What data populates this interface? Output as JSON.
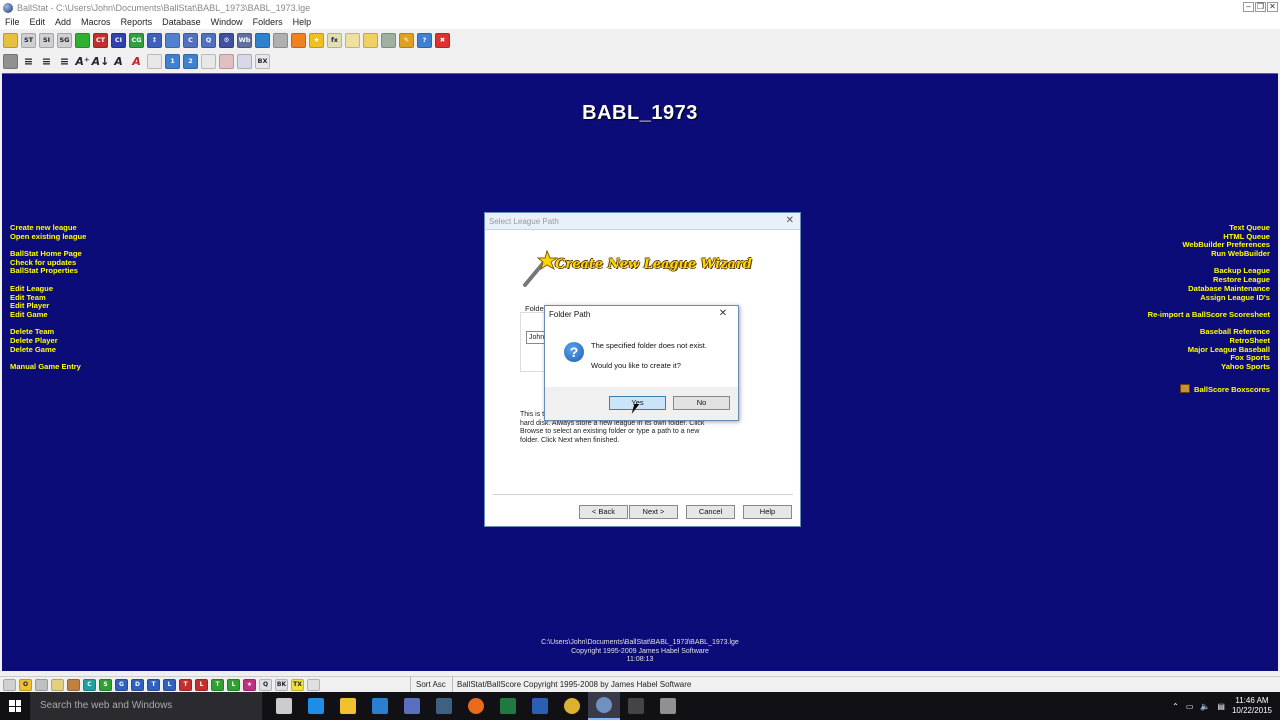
{
  "window": {
    "title": "BallStat - C:\\Users\\John\\Documents\\BallStat\\BABL_1973\\BABL_1973.lge",
    "buttons": [
      "minimize",
      "restore",
      "close"
    ]
  },
  "menu": [
    "File",
    "Edit",
    "Add",
    "Macros",
    "Reports",
    "Database",
    "Window",
    "Folders",
    "Help"
  ],
  "toolbar1": [
    {
      "icon": "open-folder-icon",
      "text": "",
      "color": "#e8c040"
    },
    {
      "icon": "st-icon",
      "text": "ST",
      "color": "#d0d0d0"
    },
    {
      "icon": "si-icon",
      "text": "SI",
      "color": "#d0d0d0"
    },
    {
      "icon": "sg-icon",
      "text": "SG",
      "color": "#d0d0d0"
    },
    {
      "icon": "green-circle-icon",
      "text": "",
      "color": "#30b030"
    },
    {
      "icon": "ct-icon",
      "text": "CT",
      "color": "#c03030"
    },
    {
      "icon": "ci-icon",
      "text": "CI",
      "color": "#3040b0"
    },
    {
      "icon": "cg-icon",
      "text": "CG",
      "color": "#30a040"
    },
    {
      "icon": "sort-icon",
      "text": "↕",
      "color": "#4060c0"
    },
    {
      "icon": "folder-blue-icon",
      "text": "",
      "color": "#5080d0"
    },
    {
      "icon": "c-icon",
      "text": "C",
      "color": "#5070c0"
    },
    {
      "icon": "q-icon",
      "text": "Q",
      "color": "#5070c0"
    },
    {
      "icon": "gear-icon",
      "text": "⚙",
      "color": "#4050a0"
    },
    {
      "icon": "wb-icon",
      "text": "Wb",
      "color": "#6070a0"
    },
    {
      "icon": "globe-icon",
      "text": "",
      "color": "#3080d0"
    },
    {
      "icon": "link-icon",
      "text": "",
      "color": "#b0b0b0"
    },
    {
      "icon": "orange-icon",
      "text": "",
      "color": "#f08020"
    },
    {
      "icon": "star-icon",
      "text": "★",
      "color": "#f0c020"
    },
    {
      "icon": "fx-icon",
      "text": "fx",
      "color": "#e0e0b0"
    },
    {
      "icon": "clipboard-icon",
      "text": "",
      "color": "#f0e0a0"
    },
    {
      "icon": "folder-icon",
      "text": "",
      "color": "#f0d060"
    },
    {
      "icon": "grid-icon",
      "text": "",
      "color": "#a0b0a0"
    },
    {
      "icon": "pencil-icon",
      "text": "✎",
      "color": "#e0a020"
    },
    {
      "icon": "help-icon",
      "text": "?",
      "color": "#4080d0"
    },
    {
      "icon": "close-icon",
      "text": "✖",
      "color": "#e03030"
    }
  ],
  "toolbar2": [
    {
      "icon": "print-icon",
      "text": "",
      "color": "#909090"
    },
    {
      "icon": "align-left-icon",
      "text": "≡",
      "color": "#f0f0f0"
    },
    {
      "icon": "align-center-icon",
      "text": "≡",
      "color": "#f0f0f0"
    },
    {
      "icon": "align-right-icon",
      "text": "≡",
      "color": "#f0f0f0"
    },
    {
      "icon": "font-larger-icon",
      "text": "A⁺",
      "color": "#f0f0f0"
    },
    {
      "icon": "font-smaller-icon",
      "text": "A↓",
      "color": "#f0f0f0"
    },
    {
      "icon": "font-icon",
      "text": "A",
      "color": "#f0f0f0"
    },
    {
      "icon": "font-red-icon",
      "text": "A",
      "color": "#f0f0f0"
    },
    {
      "icon": "page-icon",
      "text": "",
      "color": "#e8e8e8"
    },
    {
      "icon": "callout-icon",
      "text": "1",
      "color": "#4080d0"
    },
    {
      "icon": "callout2-icon",
      "text": "2",
      "color": "#4080d0"
    },
    {
      "icon": "doc-icon",
      "text": "",
      "color": "#e8e8e8"
    },
    {
      "icon": "doc-red-icon",
      "text": "",
      "color": "#e0c0c0"
    },
    {
      "icon": "table-icon",
      "text": "",
      "color": "#d8d8e8"
    },
    {
      "icon": "bx-icon",
      "text": "BX",
      "color": "#e8e8e8"
    }
  ],
  "main": {
    "title": "BABL_1973",
    "bg_color": "#0c0c78",
    "link_color": "#ffff00",
    "left_links": [
      [
        "Create new league",
        "Open existing league"
      ],
      [
        "BallStat Home Page",
        "Check for updates",
        "BallStat Properties"
      ],
      [
        "Edit League",
        "Edit Team",
        "Edit Player",
        "Edit Game"
      ],
      [
        "Delete Team",
        "Delete Player",
        "Delete Game"
      ],
      [
        "Manual Game Entry"
      ]
    ],
    "right_links": [
      [
        "Text Queue",
        "HTML Queue",
        "WebBuilder Preferences",
        "Run WebBuilder"
      ],
      [
        "Backup League",
        "Restore League",
        "Database Maintenance",
        "Assign League ID's"
      ],
      [
        "Re-import a BallScore Scoresheet"
      ],
      [
        "Baseball Reference",
        "RetroSheet",
        "Major League Baseball",
        "Fox Sports",
        "Yahoo Sports"
      ],
      [
        "BallScore Boxscores"
      ]
    ],
    "footer": {
      "path": "C:\\Users\\John\\Documents\\BallStat\\BABL_1973\\BABL_1973.lge",
      "copyright": "Copyright 1995-2009 James Habel Software",
      "time": "11:08:13"
    }
  },
  "wizard": {
    "title": "Select League Path",
    "banner": "Create New League Wizard",
    "folder_label": "Folder",
    "folder_value": "John",
    "description_prefix": "This is t",
    "description_rest": "hard disk. Always store a new league in its own folder. Click Browse to select an existing folder or type a path to a new folder. Click Next when finished.",
    "buttons": {
      "back": "< Back",
      "next": "Next >",
      "cancel": "Cancel",
      "help": "Help"
    }
  },
  "msgbox": {
    "title": "Folder Path",
    "line1": "The specified folder does not exist.",
    "line2": "Would you like to create it?",
    "yes": "Yes",
    "no": "No"
  },
  "statusbar": {
    "icons": [
      {
        "icon": "edit-icon",
        "text": "",
        "color": "#d0d0d0"
      },
      {
        "icon": "o-icon",
        "text": "O",
        "color": "#f0c030"
      },
      {
        "icon": "book-icon",
        "text": "",
        "color": "#c0c0c0"
      },
      {
        "icon": "folder-open-icon",
        "text": "",
        "color": "#e0d080"
      },
      {
        "icon": "box-icon",
        "text": "",
        "color": "#c08040"
      },
      {
        "icon": "c-green-icon",
        "text": "C",
        "color": "#20a0a0"
      },
      {
        "icon": "s-green-icon",
        "text": "S",
        "color": "#30a030"
      },
      {
        "icon": "g-blue-icon",
        "text": "G",
        "color": "#3060c0"
      },
      {
        "icon": "d-blue-icon",
        "text": "D",
        "color": "#3060c0"
      },
      {
        "icon": "t-blue-icon",
        "text": "T",
        "color": "#3060c0"
      },
      {
        "icon": "l-blue-icon",
        "text": "L",
        "color": "#3060c0"
      },
      {
        "icon": "t-red-icon",
        "text": "T",
        "color": "#c03030"
      },
      {
        "icon": "l-red-icon",
        "text": "L",
        "color": "#c03030"
      },
      {
        "icon": "t-green-icon",
        "text": "T",
        "color": "#30a030"
      },
      {
        "icon": "l-green-icon",
        "text": "L",
        "color": "#30a030"
      },
      {
        "icon": "star-red-icon",
        "text": "★",
        "color": "#c03080"
      },
      {
        "icon": "q-white-icon",
        "text": "Q",
        "color": "#e0e0e0"
      },
      {
        "icon": "bk-icon",
        "text": "BK",
        "color": "#e0e0e0"
      },
      {
        "icon": "tx-icon",
        "text": "TX",
        "color": "#f0e040"
      },
      {
        "icon": "chart-icon",
        "text": "",
        "color": "#e0e0e0"
      }
    ],
    "sort": "Sort Asc",
    "copyright": "BallStat/BallScore  Copyright 1995-2008 by James Habel Software"
  },
  "taskbar": {
    "search_placeholder": "Search the web and Windows",
    "apps": [
      {
        "icon": "task-view-icon",
        "color": "#cccccc"
      },
      {
        "icon": "edge-icon",
        "color": "#1f8ce6"
      },
      {
        "icon": "file-explorer-icon",
        "color": "#f0c030"
      },
      {
        "icon": "store-icon",
        "color": "#2a7fd0"
      },
      {
        "icon": "media-icon",
        "color": "#5a6fc0"
      },
      {
        "icon": "app-icon",
        "color": "#406080"
      },
      {
        "icon": "firefox-icon",
        "color": "#e86a1a"
      },
      {
        "icon": "excel-icon",
        "color": "#1f7a3f"
      },
      {
        "icon": "word-icon",
        "color": "#2b5fb3"
      },
      {
        "icon": "chrome-icon",
        "color": "#dcb030"
      },
      {
        "icon": "ballstat-icon",
        "color": "#7090c0"
      },
      {
        "icon": "cmd-icon",
        "color": "#444444"
      },
      {
        "icon": "calculator-icon",
        "color": "#909090"
      }
    ],
    "active_index": 10,
    "time": "11:46 AM",
    "date": "10/22/2015"
  }
}
